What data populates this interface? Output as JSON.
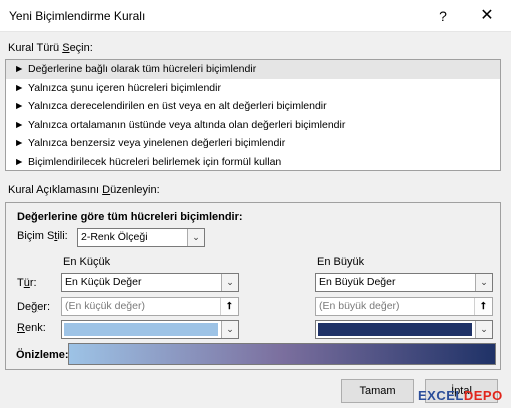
{
  "window": {
    "title": "Yeni Biçimlendirme Kuralı",
    "help_symbol": "?",
    "close_symbol": "✕"
  },
  "rule_type": {
    "label_pre": "Kural Türü ",
    "label_key": "S",
    "label_post": "eçin:",
    "items": [
      {
        "label": "Değerlerine bağlı olarak tüm hücreleri biçimlendir",
        "selected": true
      },
      {
        "label": "Yalnızca şunu içeren hücreleri biçimlendir",
        "selected": false
      },
      {
        "label": "Yalnızca derecelendirilen en üst veya en alt değerleri biçimlendir",
        "selected": false
      },
      {
        "label": "Yalnızca ortalamanın üstünde veya altında olan değerleri biçimlendir",
        "selected": false
      },
      {
        "label": "Yalnızca benzersiz veya yinelenen değerleri biçimlendir",
        "selected": false
      },
      {
        "label": "Biçimlendirilecek hücreleri belirlemek için formül kullan",
        "selected": false
      }
    ],
    "item_arrow": "►"
  },
  "description": {
    "label_pre": "Kural Açıklamasını ",
    "label_key": "D",
    "label_post": "üzenleyin:",
    "heading": "Değerlerine göre tüm hücreleri biçimlendir:",
    "format_style_label_pre": "Biçim S",
    "format_style_label_key": "t",
    "format_style_label_post": "ili:",
    "format_style_value": "2-Renk Ölçeği",
    "min_header": "En Küçük",
    "max_header": "En Büyük",
    "type_label_pre": "T",
    "type_label_key": "ü",
    "type_label_post": "r:",
    "min_type": "En Küçük Değer",
    "max_type": "En Büyük Değer",
    "value_label_pre": "De",
    "value_label_key": "ğ",
    "value_label_post": "er:",
    "min_value_placeholder": "(En küçük değer)",
    "max_value_placeholder": "(En büyük değer)",
    "color_label_pre": "",
    "color_label_key": "R",
    "color_label_post": "enk:",
    "preview_label": "Önizleme:",
    "dropdown_symbol": "⌄",
    "picker_symbol": "⭡"
  },
  "colors": {
    "min_color": "#9dc3e6",
    "max_color": "#1f3267",
    "preview_mid": "#7b6f9e"
  },
  "buttons": {
    "ok": "Tamam",
    "cancel": "İptal"
  },
  "watermark": {
    "part1": "EXCEL",
    "part2": "DEPO"
  }
}
